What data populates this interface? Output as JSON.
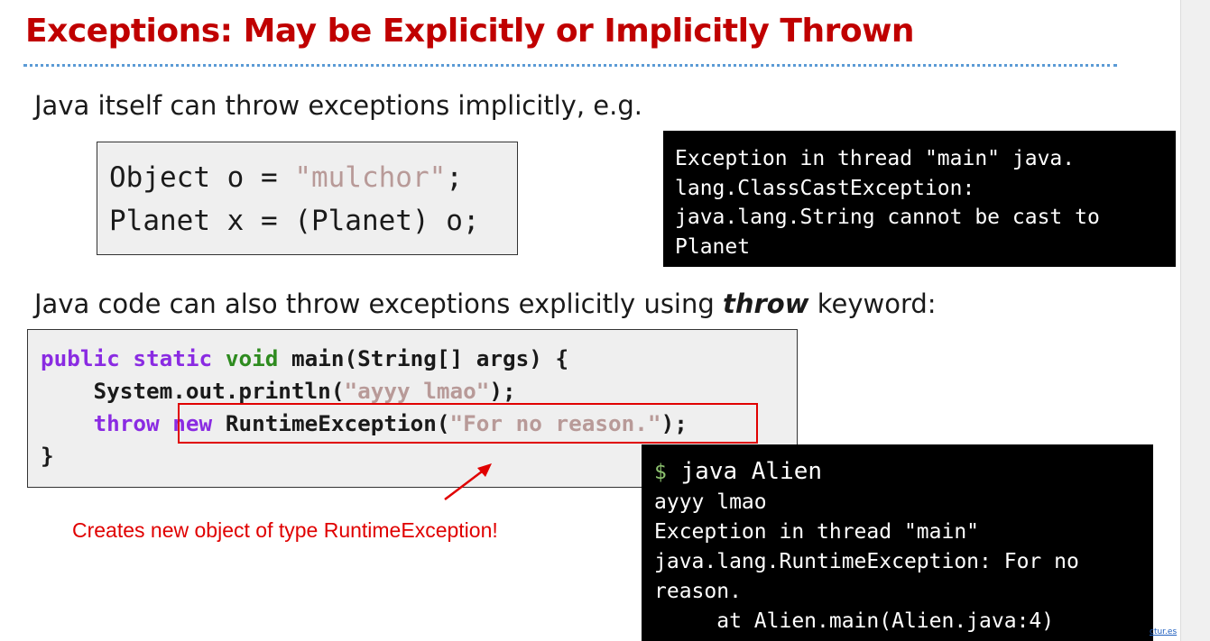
{
  "slide": {
    "title": "Exceptions: May be Explicitly or Implicitly Thrown",
    "implicit_text": "Java itself can throw exceptions implicitly, e.g.",
    "explicit_text_before": "Java code can also throw exceptions explicitly using ",
    "explicit_keyword": "throw",
    "explicit_text_after": " keyword:",
    "annotation": "Creates new object of type RuntimeException!",
    "footer_link": "ctur.es"
  },
  "code_implicit": {
    "line1_prefix": "Object o = ",
    "line1_string": "\"mulchor\"",
    "line1_suffix": ";",
    "line2": "Planet x = (Planet) o;"
  },
  "terminal_implicit": {
    "lines": [
      "Exception in thread \"main\" java.",
      "lang.ClassCastException:",
      "java.lang.String cannot be cast to",
      "Planet"
    ]
  },
  "code_explicit": {
    "kw_public": "public",
    "kw_static": "static",
    "kw_void": "void",
    "line1_rest": " main(String[] args) {",
    "line2_prefix": "    System.out.println(",
    "line2_string": "\"ayyy lmao\"",
    "line2_suffix": ");",
    "line3_indent": "    ",
    "kw_throw": "throw",
    "kw_new": "new",
    "line3_mid": " RuntimeException(",
    "line3_string": "\"For no reason.\"",
    "line3_suffix": ");",
    "line4": "}"
  },
  "terminal_explicit": {
    "prompt": "$",
    "command": " java Alien",
    "lines": [
      "ayyy lmao",
      "Exception in thread \"main\"",
      "java.lang.RuntimeException: For no",
      "reason.",
      "     at Alien.main(Alien.java:4)"
    ]
  },
  "colors": {
    "title": "#c00000",
    "keyword_purple": "#8a2be2",
    "keyword_green": "#2e8b1f",
    "string": "#b89a98",
    "annotation_red": "#e00000",
    "divider_blue": "#5b9bd5"
  }
}
